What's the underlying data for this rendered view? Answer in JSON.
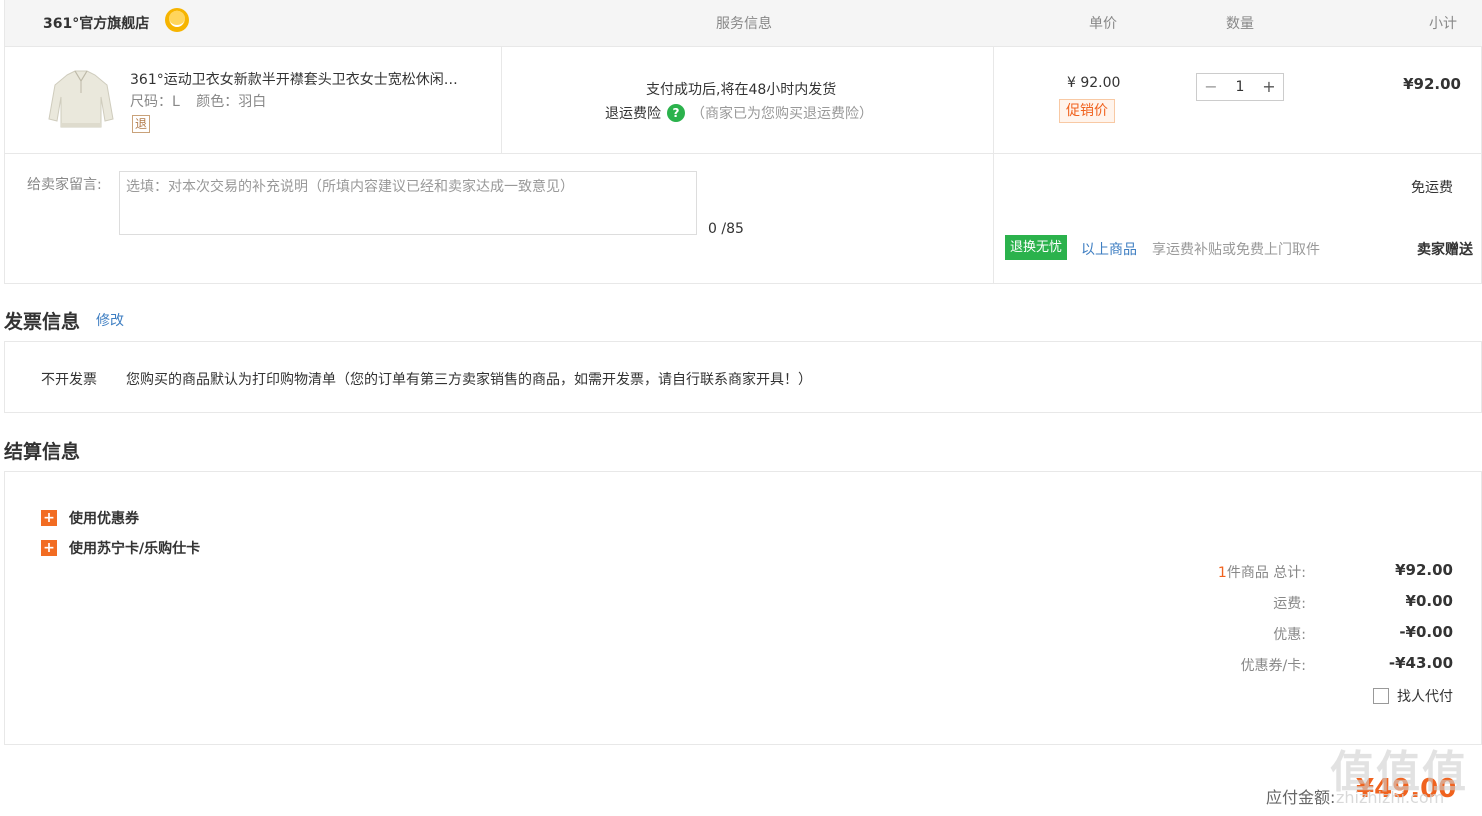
{
  "header": {
    "shop_name": "361°官方旗舰店",
    "service_col": "服务信息",
    "price_col": "单价",
    "qty_col": "数量",
    "subtotal_col": "小计"
  },
  "item": {
    "title": "361°运动卫衣女新款半开襟套头卫衣女士宽松休闲…",
    "size": "尺码：L",
    "color": "颜色：羽白",
    "refund_tag": "退",
    "service_line1": "支付成功后,将在48小时内发货",
    "return_insurance": "退运费险",
    "return_note": "（商家已为您购买退运费险）",
    "unit_price": "¥ 92.00",
    "promo_tag": "促销价",
    "quantity": "1",
    "minus": "−",
    "plus": "+",
    "subtotal": "¥92.00"
  },
  "message": {
    "label": "给卖家留言:",
    "placeholder": "选填：对本次交易的补充说明（所填内容建议已经和卖家达成一致意见）",
    "counter": "0 /85"
  },
  "shipping": {
    "free": "免运费",
    "exchange_tag": "退换无忧",
    "exchange_link": "以上商品",
    "exchange_desc": "享运费补贴或免费上门取件",
    "seller_gift": "卖家赠送"
  },
  "invoice": {
    "title": "发票信息",
    "modify": "修改",
    "type": "不开发票",
    "desc": "您购买的商品默认为打印购物清单（您的订单有第三方卖家销售的商品，如需开发票，请自行联系商家开具！）"
  },
  "settlement": {
    "title": "结算信息",
    "coupon_option": "使用优惠券",
    "card_option": "使用苏宁卡/乐购仕卡",
    "item_count": "1",
    "item_total_label": "件商品 总计:",
    "item_total": "¥92.00",
    "freight_label": "运费:",
    "freight": "¥0.00",
    "discount_label": "优惠:",
    "discount": "-¥0.00",
    "coupon_label": "优惠券/卡:",
    "coupon": "-¥43.00",
    "proxy_pay": "找人代付",
    "payable_label": "应付金额:",
    "payable": "¥49.00"
  },
  "watermark": {
    "main": "值值值",
    "sub": "zhizhizhi.com"
  },
  "colors": {
    "accent_orange": "#f0621e",
    "link_blue": "#3e7ec2",
    "green": "#2bb24c"
  }
}
